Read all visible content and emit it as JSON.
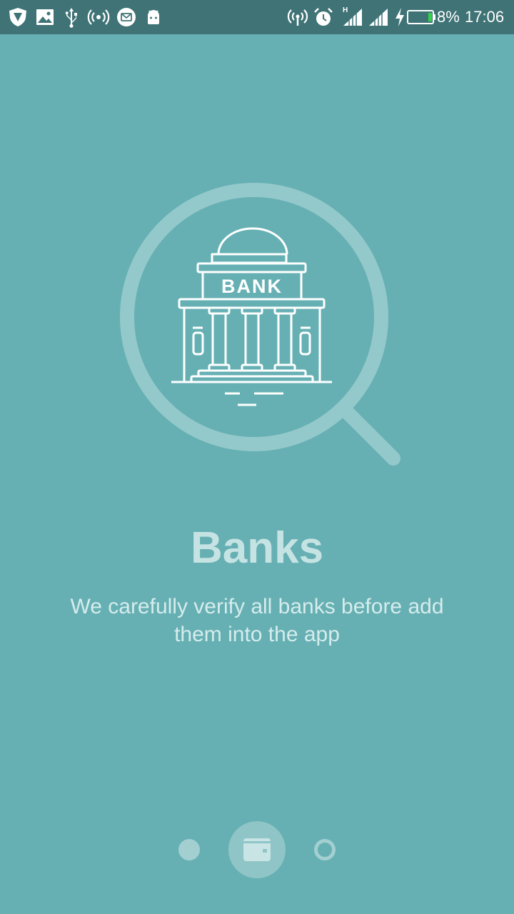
{
  "status_bar": {
    "battery_percent": "8%",
    "time": "17:06",
    "network_type": "H",
    "left_icons": [
      "shield-icon",
      "image-icon",
      "usb-icon",
      "hotspot-icon",
      "mail-icon",
      "android-icon"
    ],
    "right_icons": [
      "wifi-hotspot-icon",
      "alarm-icon",
      "signal-icon",
      "signal-icon",
      "charging-icon",
      "battery-icon"
    ]
  },
  "illustration": {
    "sign_text": "BANK",
    "icon": "bank-search-icon"
  },
  "onboarding": {
    "title": "Banks",
    "description": "We carefully verify all banks before add them into the app"
  },
  "pager": {
    "page_count": 3,
    "current_page": 2,
    "current_icon": "wallet-icon"
  },
  "colors": {
    "background": "#66b0b4",
    "status_bar": "#3f7376",
    "title": "#c6e3e4",
    "pager": "#a3cfd1"
  }
}
